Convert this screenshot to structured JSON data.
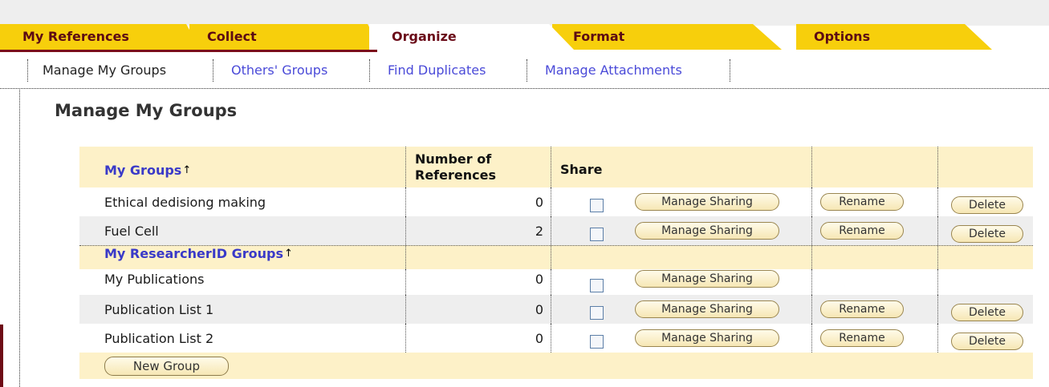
{
  "tabs": [
    {
      "label": "My References",
      "active": false
    },
    {
      "label": "Collect",
      "active": false
    },
    {
      "label": "Organize",
      "active": true
    },
    {
      "label": "Format",
      "active": false
    },
    {
      "label": "Options",
      "active": false
    }
  ],
  "subnav": [
    {
      "label": "Manage My Groups",
      "current": true
    },
    {
      "label": "Others' Groups",
      "current": false
    },
    {
      "label": "Find Duplicates",
      "current": false
    },
    {
      "label": "Manage Attachments",
      "current": false
    }
  ],
  "page_title": "Manage My Groups",
  "table": {
    "headers": {
      "groups": "My Groups",
      "sort_icon": "↑",
      "refs": "Number of References",
      "share": "Share"
    },
    "my_groups": [
      {
        "name": "Ethical dedisiong making",
        "count": "0",
        "shared": false,
        "share_btn": "Manage Sharing",
        "rename_btn": "Rename",
        "delete_btn": "Delete"
      },
      {
        "name": "Fuel Cell",
        "count": "2",
        "shared": false,
        "share_btn": "Manage Sharing",
        "rename_btn": "Rename",
        "delete_btn": "Delete"
      }
    ],
    "researcherid_header": "My ResearcherID Groups",
    "researcherid_groups": [
      {
        "name": "My Publications",
        "count": "0",
        "shared": false,
        "share_btn": "Manage Sharing"
      },
      {
        "name": "Publication List 1",
        "count": "0",
        "shared": false,
        "share_btn": "Manage Sharing",
        "rename_btn": "Rename",
        "delete_btn": "Delete"
      },
      {
        "name": "Publication List 2",
        "count": "0",
        "shared": false,
        "share_btn": "Manage Sharing",
        "rename_btn": "Rename",
        "delete_btn": "Delete"
      }
    ],
    "new_group_btn": "New Group"
  },
  "colors": {
    "tab_yellow": "#f7cf0c",
    "tab_text": "#5c0a14",
    "link_blue": "#3a3ac8",
    "header_bg": "#fdf1c8",
    "row_gray": "#eeeeee"
  }
}
